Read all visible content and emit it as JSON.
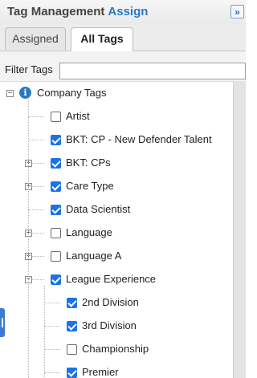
{
  "header": {
    "title": "Tag Management",
    "title_accent": "Assign",
    "collapse_icon": "»"
  },
  "tabs": [
    {
      "label": "Assigned",
      "active": false
    },
    {
      "label": "All Tags",
      "active": true
    }
  ],
  "filter": {
    "label": "Filter Tags",
    "value": ""
  },
  "tree": {
    "root": {
      "label": "Company Tags",
      "icon": "info-icon",
      "expanded": true
    },
    "items": [
      {
        "label": "Artist",
        "checked": false,
        "expandable": false
      },
      {
        "label": "BKT: CP - New Defender Talent",
        "checked": true,
        "expandable": false
      },
      {
        "label": "BKT: CPs",
        "checked": true,
        "expandable": true,
        "expanded": false
      },
      {
        "label": "Care Type",
        "checked": true,
        "expandable": true,
        "expanded": false
      },
      {
        "label": "Data Scientist",
        "checked": true,
        "expandable": false
      },
      {
        "label": "Language",
        "checked": false,
        "expandable": true,
        "expanded": false
      },
      {
        "label": "Language A",
        "checked": false,
        "expandable": true,
        "expanded": false
      },
      {
        "label": "League Experience",
        "checked": true,
        "expandable": true,
        "expanded": true,
        "children": [
          {
            "label": "2nd Division",
            "checked": true
          },
          {
            "label": "3rd Division",
            "checked": true
          },
          {
            "label": "Championship",
            "checked": false
          },
          {
            "label": "Premier",
            "checked": true
          }
        ]
      }
    ]
  }
}
